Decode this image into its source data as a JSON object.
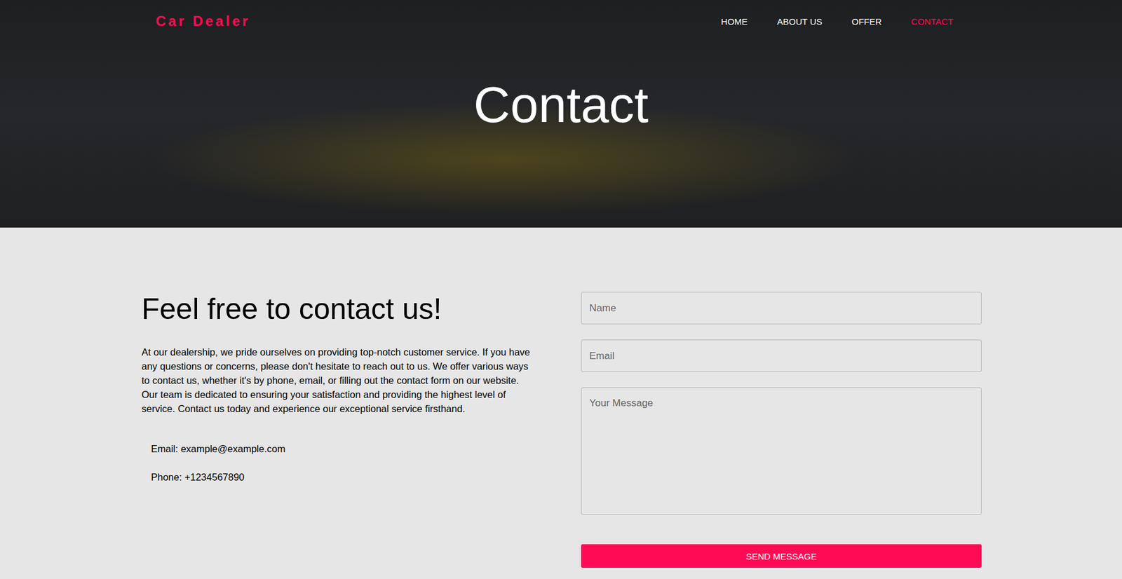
{
  "header": {
    "logo": "Car Dealer",
    "title": "Contact"
  },
  "nav": [
    {
      "label": "HOME",
      "selected": false
    },
    {
      "label": "ABOUT US",
      "selected": false
    },
    {
      "label": "OFFER",
      "selected": false
    },
    {
      "label": "CONTACT",
      "selected": true
    }
  ],
  "intro": {
    "heading": "Feel free to contact us!",
    "text": "At our dealership, we pride ourselves on providing top-notch customer service. If you have any questions or concerns, please don't hesitate to reach out to us. We offer various ways to contact us, whether it's by phone, email, or filling out the contact form on our website. Our team is dedicated to ensuring your satisfaction and providing the highest level of service. Contact us today and experience our exceptional service firsthand."
  },
  "contacts": [
    "Email: example@example.com",
    "Phone: +1234567890"
  ],
  "form": {
    "name_placeholder": "Name",
    "email_placeholder": "Email",
    "message_placeholder": "Your Message",
    "submit": "SEND MESSAGE"
  }
}
